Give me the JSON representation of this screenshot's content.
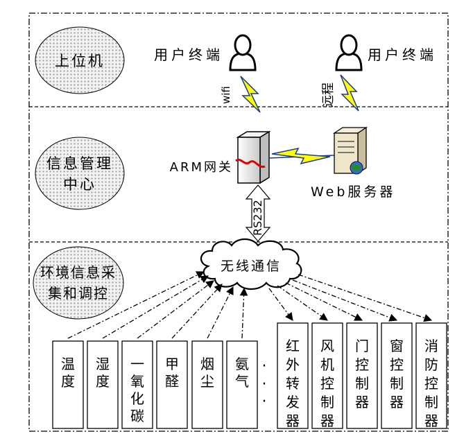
{
  "layers": [
    {
      "label_lines": [
        "上位机"
      ]
    },
    {
      "label_lines": [
        "信息管理",
        "中心"
      ]
    },
    {
      "label_lines": [
        "环境信息采",
        "集和调控"
      ]
    }
  ],
  "user_terminal_left": "用户终端",
  "user_terminal_right": "用户终端",
  "link_wifi": "wifi",
  "link_remote": "远程",
  "gateway_label": "ARM网关",
  "web_server_label": "Web服务器",
  "rs232_label": "RS232",
  "wireless_label": "无线通信",
  "sensors": [
    {
      "chars": [
        "温",
        "度"
      ]
    },
    {
      "chars": [
        "湿",
        "度"
      ]
    },
    {
      "chars": [
        "一",
        "氧",
        "化",
        "碳"
      ]
    },
    {
      "chars": [
        "甲",
        "醛"
      ]
    },
    {
      "chars": [
        "烟",
        "尘"
      ]
    },
    {
      "chars": [
        "氨",
        "气"
      ]
    }
  ],
  "ellipsis_dots": [
    "·",
    "·",
    "·"
  ],
  "controllers": [
    {
      "chars": [
        "红",
        "外",
        "转",
        "发",
        "器"
      ]
    },
    {
      "chars": [
        "风",
        "机",
        "控",
        "制",
        "器"
      ]
    },
    {
      "chars": [
        "门",
        "控",
        "制",
        "器"
      ]
    },
    {
      "chars": [
        "窗",
        "控",
        "制",
        "器"
      ]
    },
    {
      "chars": [
        "消",
        "防",
        "控",
        "制",
        "器"
      ]
    }
  ],
  "colors": {
    "lightning": "#ffff00",
    "lightning_stroke": "#1a3a8a",
    "ellipse_fill": "#d9d9d9",
    "red_cable": "#e00000",
    "globe": "#2a8a2a"
  }
}
